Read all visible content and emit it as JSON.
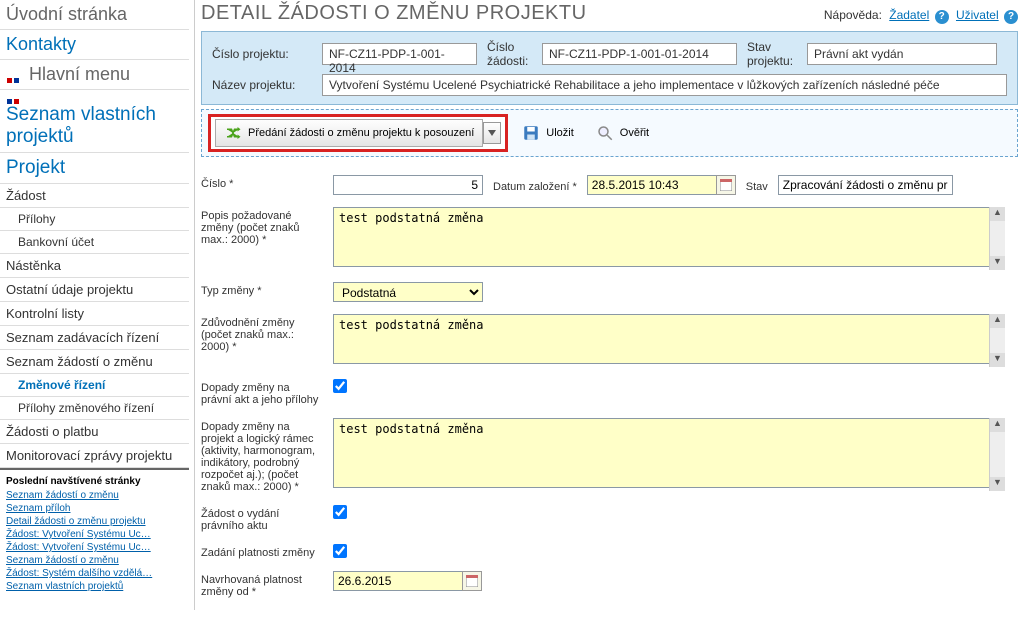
{
  "sidebar": {
    "uvod": "Úvodní stránka",
    "kontakty": "Kontakty",
    "hlavni_menu": "Hlavní menu",
    "seznam_vlastnich": "Seznam vlastních projektů",
    "projekt": "Projekt",
    "zadost": "Žádost",
    "prilohy": "Přílohy",
    "bankovni_ucet": "Bankovní účet",
    "nastenka": "Nástěnka",
    "ostatni_udaje": "Ostatní údaje projektu",
    "kontrolni_listy": "Kontrolní listy",
    "seznam_zadavacich": "Seznam zadávacích řízení",
    "seznam_zadosti_zmenu": "Seznam žádostí o změnu",
    "zmenove_rizeni": "Změnové řízení",
    "prilohy_zmenoveho": "Přílohy změnového řízení",
    "zadosti_platbu": "Žádosti o platbu",
    "monitorovaci": "Monitorovací zprávy projektu"
  },
  "recent": {
    "title": "Poslední navštívené stránky",
    "r1": "Seznam žádostí o změnu",
    "r2": "Seznam příloh",
    "r3": "Detail žádosti o změnu projektu",
    "r4": "Žádost: Vytvoření Systému Uc…",
    "r5": "Žádost: Vytvoření Systému Uc…",
    "r6": "Seznam žádostí o změnu",
    "r7": "Žádost: Systém dalšího vzdělá…",
    "r8": "Seznam vlastních projektů"
  },
  "header": {
    "title": "DETAIL ŽÁDOSTI O ZMĚNU PROJEKTU",
    "help_label": "Nápověda:",
    "zadatel": "Žadatel",
    "uzivatel": "Uživatel"
  },
  "info": {
    "cislo_projektu_label": "Číslo projektu:",
    "cislo_projektu": "NF-CZ11-PDP-1-001-2014",
    "cislo_zadosti_label": "Číslo žádosti:",
    "cislo_zadosti": "NF-CZ11-PDP-1-001-01-2014",
    "stav_projektu_label": "Stav projektu:",
    "stav_projektu": "Právní akt vydán",
    "nazev_projektu_label": "Název projektu:",
    "nazev_projektu": "Vytvoření Systému Ucelené Psychiatrické Rehabilitace a jeho implementace v lůžkových zařízeních následné péče"
  },
  "toolbar": {
    "predani": "Předání žádosti o změnu projektu k posouzení",
    "ulozit": "Uložit",
    "overit": "Ověřit"
  },
  "form": {
    "cislo_label": "Číslo *",
    "cislo_value": "5",
    "datum_zalozeni_label": "Datum založení *",
    "datum_zalozeni_value": "28.5.2015 10:43",
    "stav_label": "Stav",
    "stav_value": "Zpracování žádosti o změnu pr",
    "popis_label": "Popis požadované změny (počet znaků max.: 2000) *",
    "popis_value": "test podstatná změna",
    "typ_zmeny_label": "Typ změny *",
    "typ_zmeny_value": "Podstatná",
    "zduvodneni_label": "Zdůvodnění změny (počet znaků max.: 2000) *",
    "zduvodneni_value": "test podstatná změna",
    "dopady_pravni_label": "Dopady změny na právní akt a jeho přílohy",
    "dopady_projekt_label": "Dopady změny na projekt a logický rámec (aktivity, harmonogram, indikátory, podrobný rozpočet aj.); (počet znaků max.: 2000) *",
    "dopady_projekt_value": "test podstatná změna",
    "zadost_vydani_label": "Žádost o vydání právního aktu",
    "zadani_platnosti_label": "Zadání platnosti změny",
    "navrhovana_label": "Navrhovaná platnost změny od *",
    "navrhovana_value": "26.6.2015"
  }
}
